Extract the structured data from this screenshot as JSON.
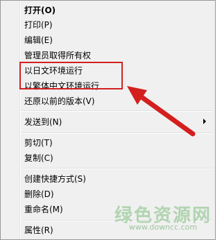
{
  "menu": {
    "items": [
      {
        "label": "打开(O)"
      },
      {
        "label": "打印(P)"
      },
      {
        "label": "编辑(E)"
      },
      {
        "label": "管理员取得所有权"
      },
      {
        "label": "以日文环境运行"
      },
      {
        "label": "以繁体中文环境运行"
      },
      {
        "label": "还原以前的版本(V)"
      },
      {
        "label": "发送到(N)"
      },
      {
        "label": "剪切(T)"
      },
      {
        "label": "复制(C)"
      },
      {
        "label": "创建快捷方式(S)"
      },
      {
        "label": "删除(D)"
      },
      {
        "label": "重命名(M)"
      },
      {
        "label": "属性(R)"
      }
    ]
  },
  "annotation": {
    "highlight_color": "#d41f1f",
    "arrow_color": "#d41f1f"
  },
  "watermark": {
    "name": "绿色资源网",
    "url": "www.downcc.com"
  }
}
